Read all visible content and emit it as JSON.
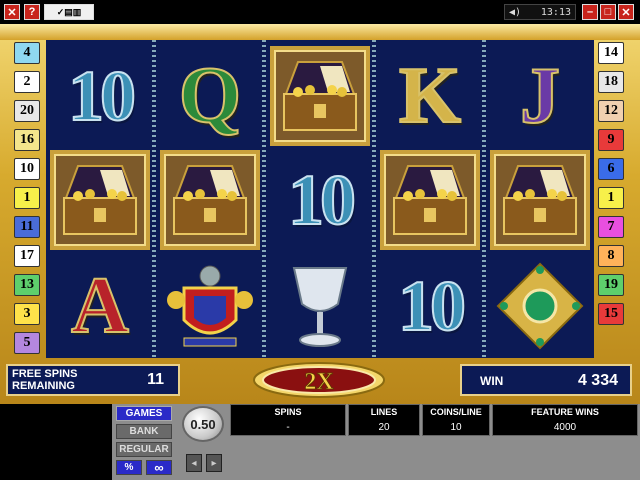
{
  "topbar": {
    "icons": [
      "close-icon",
      "help-icon",
      "stats-icon"
    ],
    "clock": "13:13",
    "window_icons": [
      "speaker-icon",
      "minimize-icon",
      "maximize-icon",
      "close-icon"
    ]
  },
  "paylines": {
    "left": [
      "4",
      "2",
      "20",
      "16",
      "10",
      "1",
      "11",
      "17",
      "13",
      "3",
      "5"
    ],
    "right": [
      "14",
      "18",
      "12",
      "9",
      "6",
      "1",
      "7",
      "8",
      "19",
      "15"
    ],
    "left_colors": [
      "#8fd8f0",
      "#ffffff",
      "#e8e8e8",
      "#f4e58c",
      "#ffffff",
      "#f7f04a",
      "#4a6cd8",
      "#ffffff",
      "#5ecf6c",
      "#ffe24a",
      "#b487e0"
    ],
    "right_colors": [
      "#ffffff",
      "#e8e8e8",
      "#f0d0b0",
      "#e83a3a",
      "#3a6ce8",
      "#f7f04a",
      "#e84fe0",
      "#ffb25a",
      "#5ecf6c",
      "#e83a3a"
    ]
  },
  "reels": [
    [
      "10",
      "chest",
      "A"
    ],
    [
      "Q",
      "chest",
      "crest"
    ],
    [
      "chest",
      "10",
      "goblet"
    ],
    [
      "K",
      "chest",
      "10"
    ],
    [
      "J",
      "chest",
      "gem"
    ]
  ],
  "symbol_names": {
    "chest": "treasure-chest-icon",
    "crest": "knight-crest-icon",
    "goblet": "silver-goblet-icon",
    "gem": "emerald-brooch-icon"
  },
  "free_spins": {
    "label": "FREE SPINS REMAINING",
    "value": "11"
  },
  "multiplier": "2X",
  "win": {
    "label": "WIN",
    "value": "4 334"
  },
  "menu": {
    "games": "GAMES",
    "bank": "BANK",
    "regular": "REGULAR",
    "percent": "%",
    "infinity": "∞"
  },
  "coin": "0.50",
  "stats": {
    "spins": {
      "label": "SPINS",
      "value": "-"
    },
    "lines": {
      "label": "LINES",
      "value": "20"
    },
    "coins_line": {
      "label": "COINS/LINE",
      "value": "10"
    },
    "feature_wins": {
      "label": "FEATURE WINS",
      "value": "4000"
    }
  },
  "colors": {
    "gold": "#d7aa2e",
    "reel_bg": "#0c1a55",
    "multiplier_red": "#8a1010"
  }
}
